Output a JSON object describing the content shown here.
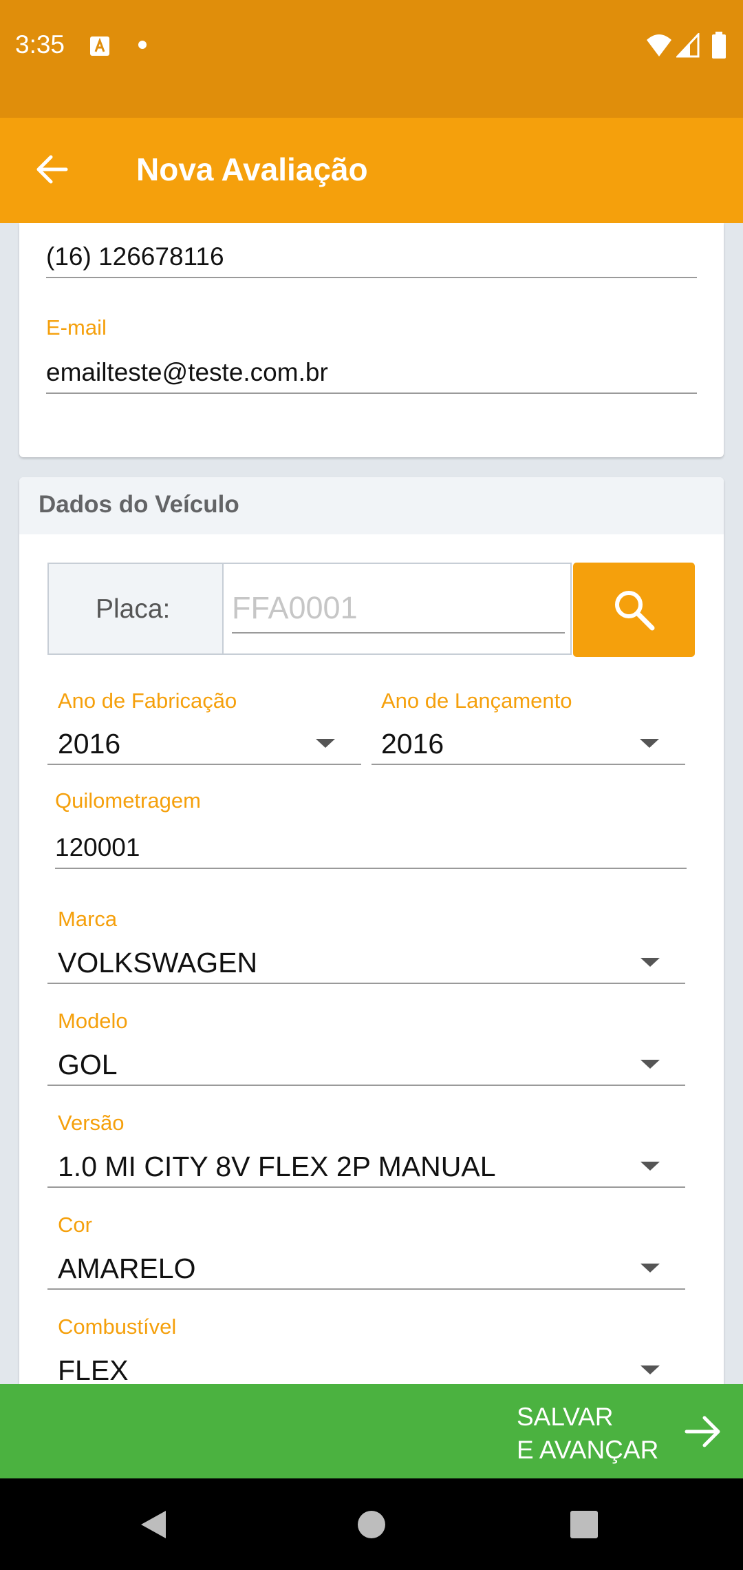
{
  "status_bar": {
    "time": "3:35"
  },
  "app_bar": {
    "title": "Nova Avaliação"
  },
  "contact": {
    "phone_value": "(16) 126678116",
    "email_label": "E-mail",
    "email_value": "emailteste@teste.com.br"
  },
  "vehicle": {
    "section_title": "Dados do Veículo",
    "plate_label": "Placa:",
    "plate_placeholder": "FFA0001",
    "year_manufacture_label": "Ano de Fabricação",
    "year_manufacture_value": "2016",
    "year_release_label": "Ano de Lançamento",
    "year_release_value": "2016",
    "mileage_label": "Quilometragem",
    "mileage_value": "120001",
    "brand_label": "Marca",
    "brand_value": "VOLKSWAGEN",
    "model_label": "Modelo",
    "model_value": "GOL",
    "version_label": "Versão",
    "version_value": "1.0 MI CITY 8V FLEX 2P MANUAL",
    "color_label": "Cor",
    "color_value": "AMARELO",
    "fuel_label": "Combustível",
    "fuel_value": "FLEX"
  },
  "footer": {
    "save_line1": "SALVAR",
    "save_line2": "E AVANÇAR"
  },
  "colors": {
    "accent": "#f5a00c",
    "status_bar": "#e08e0b",
    "save_button": "#4bb240"
  }
}
